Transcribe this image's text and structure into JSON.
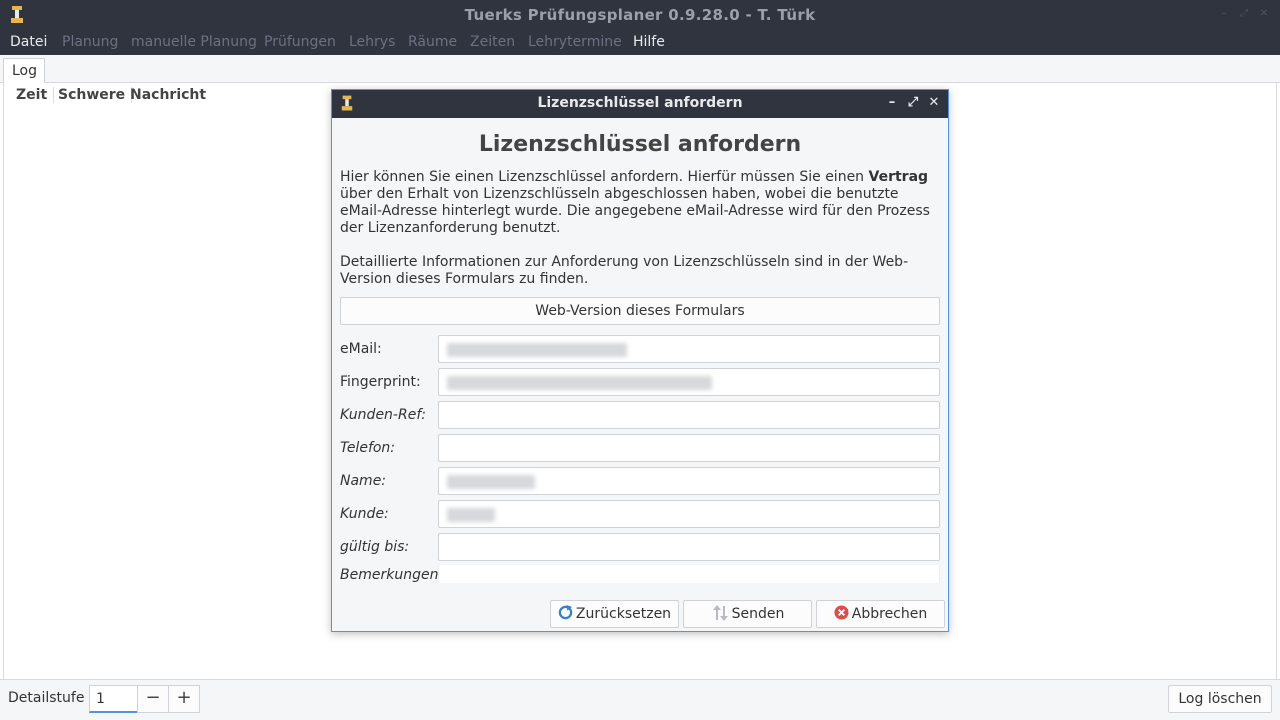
{
  "window": {
    "title": "Tuerks Prüfungsplaner 0.9.28.0 - T. Türk",
    "icon": "planner-app-icon"
  },
  "menu": {
    "items": [
      {
        "label": "Datei",
        "enabled": true
      },
      {
        "label": "Planung",
        "enabled": false
      },
      {
        "label": "manuelle Planung",
        "enabled": false
      },
      {
        "label": "Prüfungen",
        "enabled": false
      },
      {
        "label": "Lehrys",
        "enabled": false
      },
      {
        "label": "Räume",
        "enabled": false
      },
      {
        "label": "Zeiten",
        "enabled": false
      },
      {
        "label": "Lehrytermine",
        "enabled": false
      },
      {
        "label": "Hilfe",
        "enabled": true
      }
    ]
  },
  "tabs": [
    {
      "label": "Log"
    }
  ],
  "log_table": {
    "columns": [
      "Zeit",
      "Schwere",
      "Nachricht"
    ]
  },
  "bottom": {
    "detail_label": "Detailstufe",
    "detail_value": "1",
    "minus": "−",
    "plus": "+",
    "clear_label": "Log löschen"
  },
  "dialog": {
    "title": "Lizenzschlüssel anfordern",
    "heading": "Lizenzschlüssel anfordern",
    "para1_a": "Hier können Sie einen Lizenzschlüssel anfordern. Hierfür müssen Sie einen ",
    "para1_bold": "Vertrag",
    "para1_b": " über den Erhalt von Lizenzschlüsseln abgeschlossen haben, wobei die benutzte eMail-Adresse hinterlegt wurde. Die angegebene eMail-Adresse wird für den Prozess der Lizenzanforderung benutzt.",
    "para2": "Detaillierte Informationen zur Anforderung von Lizenzschlüsseln sind in der Web-Version dieses Formulars zu finden.",
    "web_button": "Web-Version dieses Formulars",
    "fields": [
      {
        "label": "eMail:",
        "optional": false
      },
      {
        "label": "Fingerprint:",
        "optional": false
      },
      {
        "label": "Kunden-Ref:",
        "optional": true
      },
      {
        "label": "Telefon:",
        "optional": true
      },
      {
        "label": "Name:",
        "optional": true
      },
      {
        "label": "Kunde:",
        "optional": true
      },
      {
        "label": "gültig bis:",
        "optional": true
      },
      {
        "label": "Bemerkungen:",
        "optional": true
      }
    ],
    "buttons": {
      "reset": "Zurücksetzen",
      "send": "Senden",
      "cancel": "Abbrechen"
    }
  },
  "colors": {
    "titlebar": "#2f343f",
    "accent": "#5294e2",
    "danger": "#e04b4b"
  }
}
